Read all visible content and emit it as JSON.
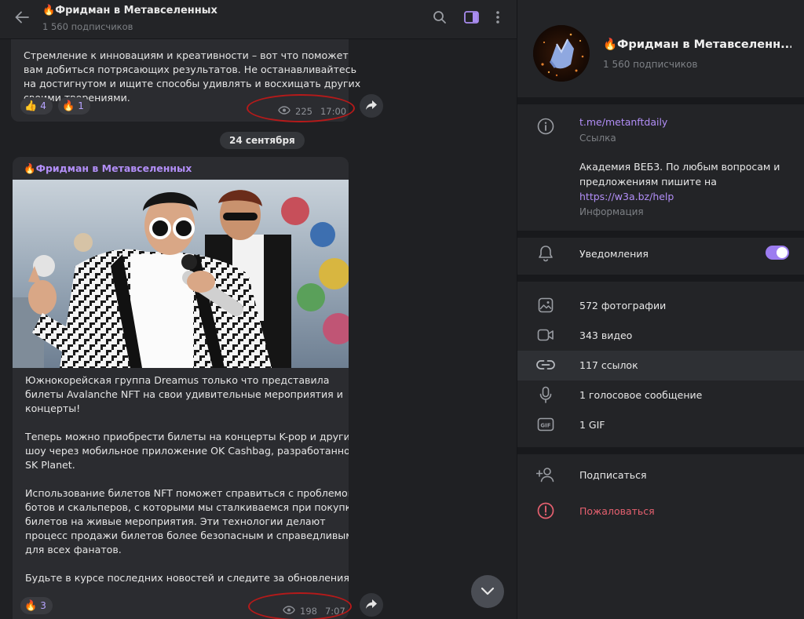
{
  "chat": {
    "header": {
      "title": "Фридман в Метавселенных",
      "title_emoji": "🔥",
      "subscribers": "1 560 подписчиков"
    },
    "message1": {
      "lines": [
        "Стремление к инновациям и креативности – вот что поможет",
        "вам добиться потрясающих результатов. Не останавливайтесь",
        "на достигнутом и ищите способы удивлять и восхищать других",
        "своими творениями."
      ],
      "reactions": [
        {
          "emoji": "👍",
          "count": "4"
        },
        {
          "emoji": "🔥",
          "count": "1"
        }
      ],
      "views": "225",
      "time": "17:00"
    },
    "date_separator": "24 сентября",
    "message2": {
      "sender": "Фридман в Метавселенных",
      "sender_emoji": "🔥",
      "paragraphs": [
        [
          "Южнокорейская группа Dreamus только что представила",
          "билеты Avalanche NFT на свои удивительные мероприятия и",
          "концерты!"
        ],
        [
          "Теперь можно приобрести билеты на концерты K-pop и другие",
          "шоу через мобильное приложение OK Cashbag, разработанное",
          "SK Planet."
        ],
        [
          "Использование билетов NFT поможет справиться с проблемой",
          "ботов и скальперов, с которыми мы сталкиваемся при покупке",
          "билетов на живые мероприятия. Эти технологии делают",
          "процесс продажи билетов более безопасным и справедливым",
          "для всех фанатов."
        ],
        [
          "Будьте в курсе последних новостей и следите за обновлениями!"
        ]
      ],
      "reactions": [
        {
          "emoji": "🔥",
          "count": "3"
        }
      ],
      "views": "198",
      "time": "7:07"
    }
  },
  "info": {
    "title": "🔥Фридман в Метавселенн...",
    "subscribers": "1 560 подписчиков",
    "link": "t.me/metanftdaily",
    "link_label": "Ссылка",
    "description_lines": [
      "Академия ВЕБ3. По любым вопросам и",
      "предложениям пишите на"
    ],
    "description_url": "https://w3a.bz/help",
    "description_label": "Информация",
    "notifications_label": "Уведомления",
    "notifications_on": true,
    "media": {
      "photos": "572 фотографии",
      "videos": "343 видео",
      "links": "117 ссылок",
      "voice": "1 голосовое сообщение",
      "gif": "1 GIF"
    },
    "subscribe": "Подписаться",
    "report": "Пожаловаться"
  },
  "colors": {
    "accent": "#b28ef7",
    "danger": "#e5606f",
    "panel": "#232427",
    "bubble": "#2b2c30"
  }
}
